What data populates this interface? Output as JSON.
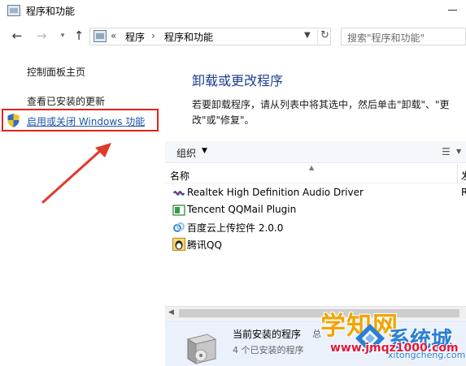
{
  "window": {
    "title": "程序和功能"
  },
  "nav": {
    "back_icon": "back-arrow-icon",
    "forward_icon": "forward-arrow-icon",
    "up_icon": "up-arrow-icon",
    "breadcrumb": [
      "程序",
      "程序和功能"
    ],
    "breadcrumb_prefix": "«",
    "breadcrumb_separator": "›",
    "search_placeholder": "搜索\"程序和功能\""
  },
  "sidebar": {
    "items": [
      {
        "label": "控制面板主页"
      },
      {
        "label": "查看已安装的更新"
      },
      {
        "label": "启用或关闭 Windows 功能",
        "highlighted": true
      }
    ],
    "highlight_color": "#e2231a"
  },
  "main": {
    "heading": "卸载或更改程序",
    "description": "若要卸载程序，请从列表中将其选中，然后单击\"卸载\"、\"更改\"或\"修复\"。",
    "organize_label": "组织",
    "columns": {
      "name": "名称",
      "publisher": "发"
    },
    "programs": [
      {
        "name": "Realtek High Definition Audio Driver",
        "icon": "realtek-icon",
        "publisher": "R"
      },
      {
        "name": "Tencent QQMail Plugin",
        "icon": "qqmail-icon",
        "publisher": ""
      },
      {
        "name": "百度云上传控件 2.0.0",
        "icon": "baidu-cloud-icon",
        "publisher": ""
      },
      {
        "name": "腾讯QQ",
        "icon": "qq-penguin-icon",
        "publisher": ""
      }
    ]
  },
  "details": {
    "title": "当前安装的程序",
    "size": "总",
    "count": "4 个已安装的程序"
  },
  "watermark": {
    "brand": "学知网",
    "site": "www.jmqz1000.com",
    "logo_text": "系统城",
    "logo_url": "xitongcheng.com",
    "brand_color": "#f0a500",
    "logo_color": "#2b7fd4"
  },
  "accent_color": "#1e3e8f",
  "link_color": "#1b53a8"
}
